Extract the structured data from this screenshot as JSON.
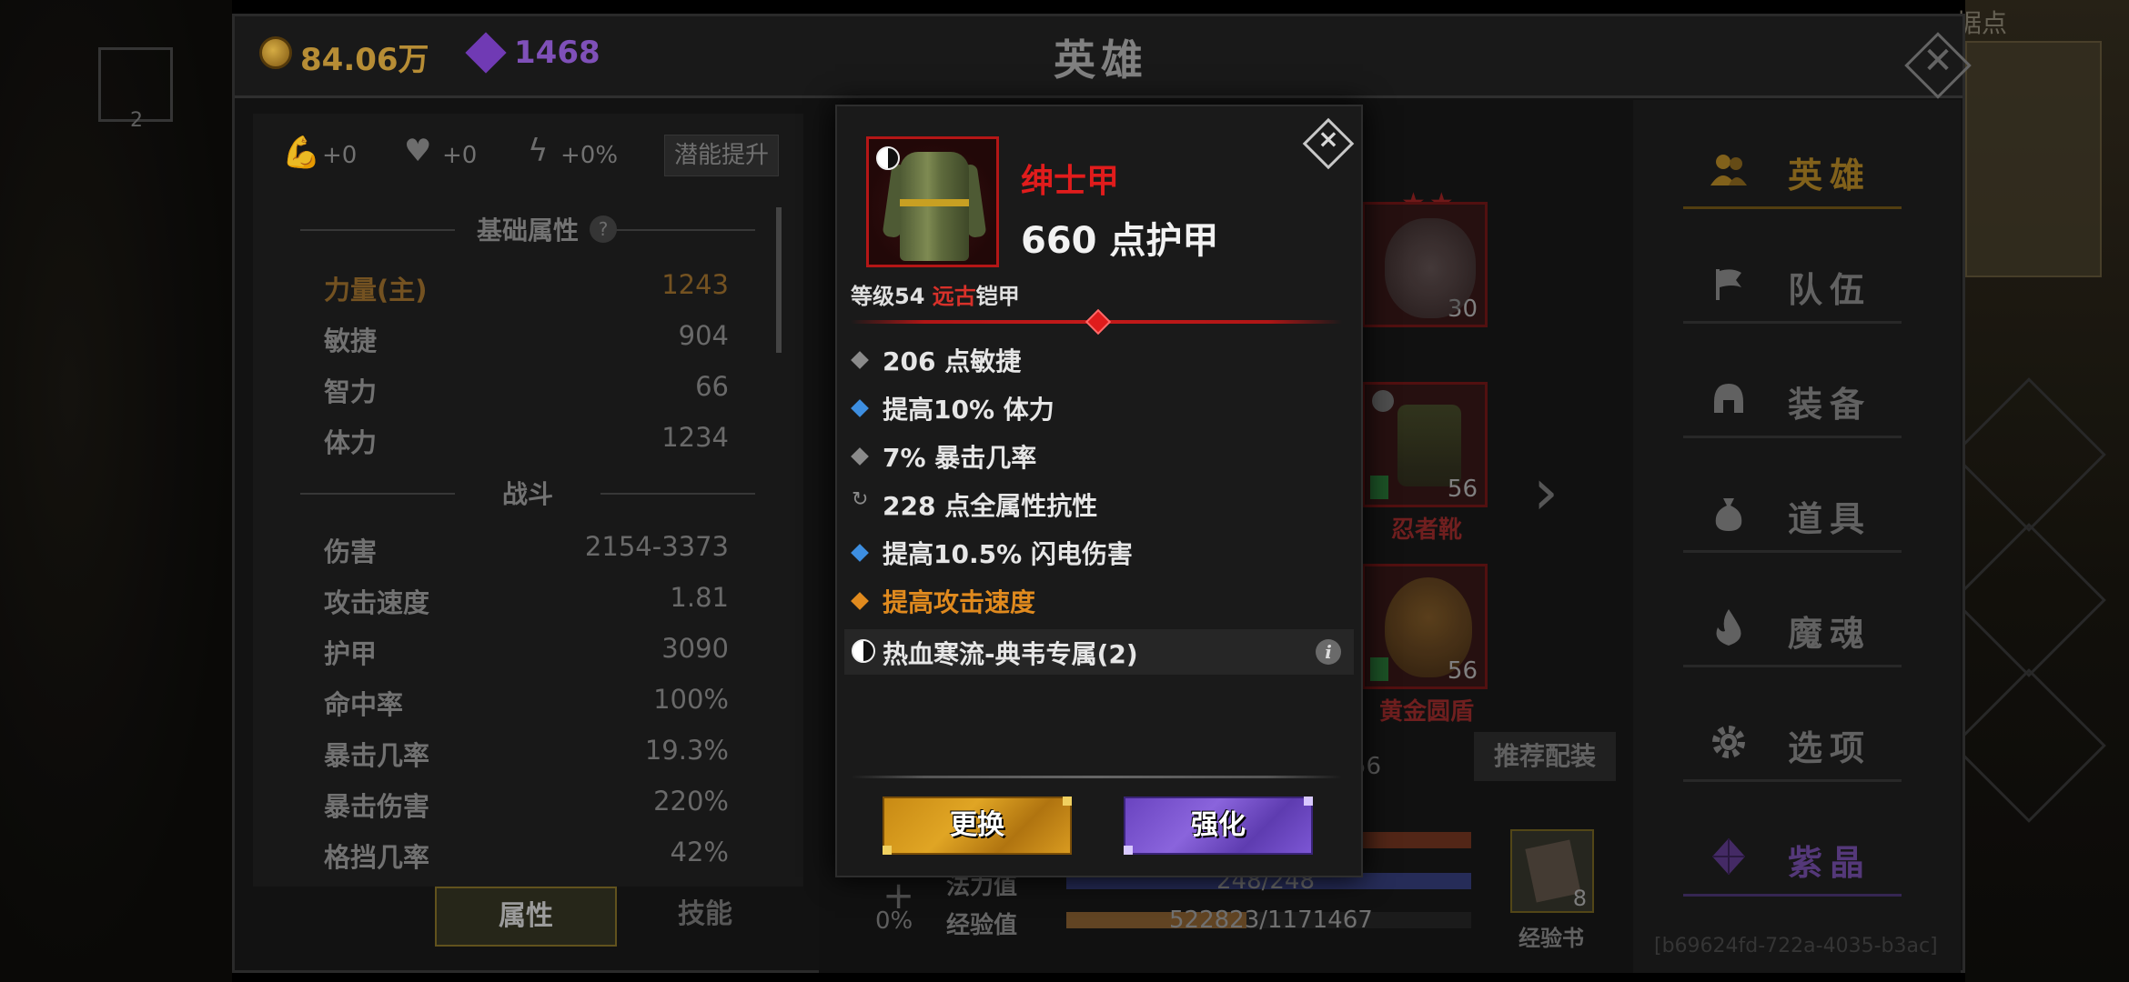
{
  "currency": {
    "gold": "84.06万",
    "gems": "1468"
  },
  "header": {
    "title": "英雄"
  },
  "background": {
    "map_label": "据点",
    "corner_count": "2"
  },
  "potential": {
    "strength_bonus": "+0",
    "health_bonus": "+0",
    "energy_bonus": "+0%",
    "button_label": "潜能提升"
  },
  "base_attributes": {
    "title": "基础属性",
    "help": "?",
    "stats": [
      {
        "name": "力量(主)",
        "value": "1243"
      },
      {
        "name": "敏捷",
        "value": "904"
      },
      {
        "name": "智力",
        "value": "66"
      },
      {
        "name": "体力",
        "value": "1234"
      }
    ]
  },
  "combat": {
    "title": "战斗",
    "stats": [
      {
        "name": "伤害",
        "value": "2154-3373"
      },
      {
        "name": "攻击速度",
        "value": "1.81"
      },
      {
        "name": "护甲",
        "value": "3090"
      },
      {
        "name": "命中率",
        "value": "100%"
      },
      {
        "name": "暴击几率",
        "value": "19.3%"
      },
      {
        "name": "暴击伤害",
        "value": "220%"
      },
      {
        "name": "格挡几率",
        "value": "42%"
      }
    ]
  },
  "bottom_tabs": {
    "attributes": "属性",
    "skills": "技能"
  },
  "equipment_bg": {
    "pet_level": "30",
    "boots_level": "56",
    "boots_name": "忍者靴",
    "shield_level": "56",
    "shield_name": "黄金圆盾",
    "recommend_button": "推荐配装",
    "side_number": "56",
    "percent": "0%",
    "mana_label": "法力值",
    "mana_value": "248/248",
    "exp_label": "经验值",
    "exp_value": "522823/1171467",
    "exp_fraction": 0.446,
    "exp_book_count": "8",
    "exp_book_label": "经验书"
  },
  "nav": [
    {
      "label": "英雄",
      "icon": "hero-icon"
    },
    {
      "label": "队伍",
      "icon": "flag-icon"
    },
    {
      "label": "装备",
      "icon": "helmet-icon"
    },
    {
      "label": "道具",
      "icon": "bag-icon"
    },
    {
      "label": "魔魂",
      "icon": "flame-icon"
    },
    {
      "label": "选项",
      "icon": "gear-icon"
    },
    {
      "label": "紫晶",
      "icon": "gem-icon"
    }
  ],
  "uuid": "[b69624fd-722a-4035-b3ac]",
  "popup": {
    "item_name": "绅士甲",
    "armor": "660 点护甲",
    "level_prefix": "等级54 ",
    "rarity": "远古",
    "item_type": "铠甲",
    "affixes": [
      {
        "text": "206 点敏捷",
        "bullet": "gray"
      },
      {
        "text": "提高10% 体力",
        "bullet": "blue"
      },
      {
        "text": "7% 暴击几率",
        "bullet": "gray"
      },
      {
        "text": "228 点全属性抗性",
        "bullet": "refresh"
      },
      {
        "text": "提高10.5% 闪电伤害",
        "bullet": "blue"
      },
      {
        "text": "提高攻击速度",
        "bullet": "orange"
      }
    ],
    "set_bonus": "热血寒流-典韦专属(2)",
    "info": "i",
    "replace_button": "更换",
    "enhance_button": "强化",
    "close": "×"
  },
  "colors": {
    "ancient_red": "#e01c1c",
    "gold_button": "#e0a524",
    "purple_button": "#8a64dc",
    "special_orange": "#e08a1e",
    "affix_blue": "#3d8ee0"
  }
}
